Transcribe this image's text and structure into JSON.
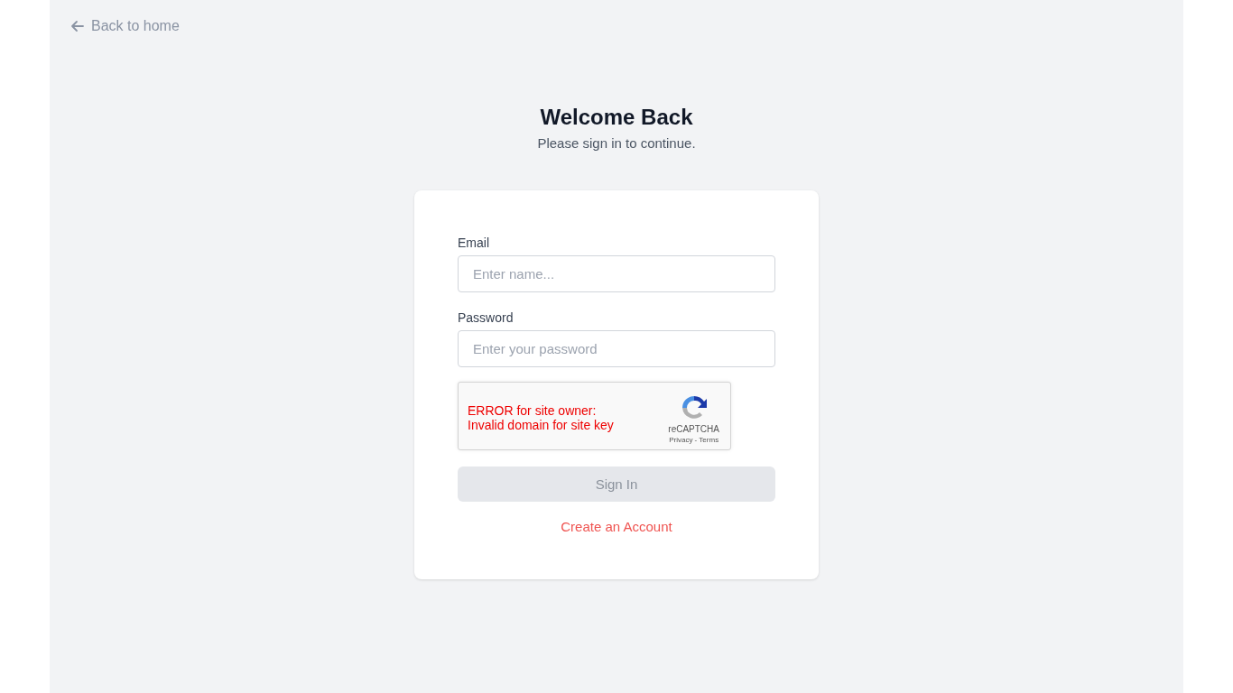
{
  "back_link": {
    "label": "Back to home"
  },
  "heading": {
    "title": "Welcome Back",
    "subtitle": "Please sign in to continue."
  },
  "form": {
    "fields": [
      {
        "label": "Email",
        "placeholder": "Enter name..."
      },
      {
        "label": "Password",
        "placeholder": "Enter your password"
      }
    ],
    "captcha": {
      "error_lines": [
        "ERROR for site owner:",
        "Invalid domain for site key"
      ],
      "brand": "reCAPTCHA",
      "links": "Privacy - Terms"
    },
    "submit": {
      "label": "Sign In",
      "disabled": true
    },
    "create_account": {
      "label": "Create an Account"
    }
  }
}
